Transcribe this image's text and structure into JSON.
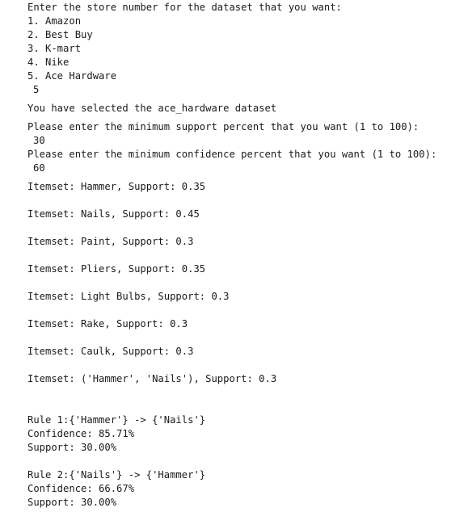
{
  "terminal": {
    "prompt_store": "Enter the store number for the dataset that you want:",
    "stores": [
      "1. Amazon",
      "2. Best Buy",
      "3. K-mart",
      "4. Nike",
      "5. Ace Hardware"
    ],
    "store_input": "5",
    "selected_msg": "You have selected the ace_hardware dataset",
    "prompt_support": "Please enter the minimum support percent that you want (1 to 100):",
    "support_input": "30",
    "prompt_confidence": "Please enter the minimum confidence percent that you want (1 to 100):",
    "confidence_input": "60",
    "itemsets": [
      "Itemset: Hammer, Support: 0.35",
      "Itemset: Nails, Support: 0.45",
      "Itemset: Paint, Support: 0.3",
      "Itemset: Pliers, Support: 0.35",
      "Itemset: Light Bulbs, Support: 0.3",
      "Itemset: Rake, Support: 0.3",
      "Itemset: Caulk, Support: 0.3",
      "Itemset: ('Hammer', 'Nails'), Support: 0.3"
    ],
    "rules": [
      {
        "rule": "Rule 1:{'Hammer'} -> {'Nails'}",
        "confidence": "Confidence: 85.71%",
        "support": "Support: 30.00%"
      },
      {
        "rule": "Rule 2:{'Nails'} -> {'Hammer'}",
        "confidence": "Confidence: 66.67%",
        "support": "Support: 30.00%"
      }
    ]
  }
}
